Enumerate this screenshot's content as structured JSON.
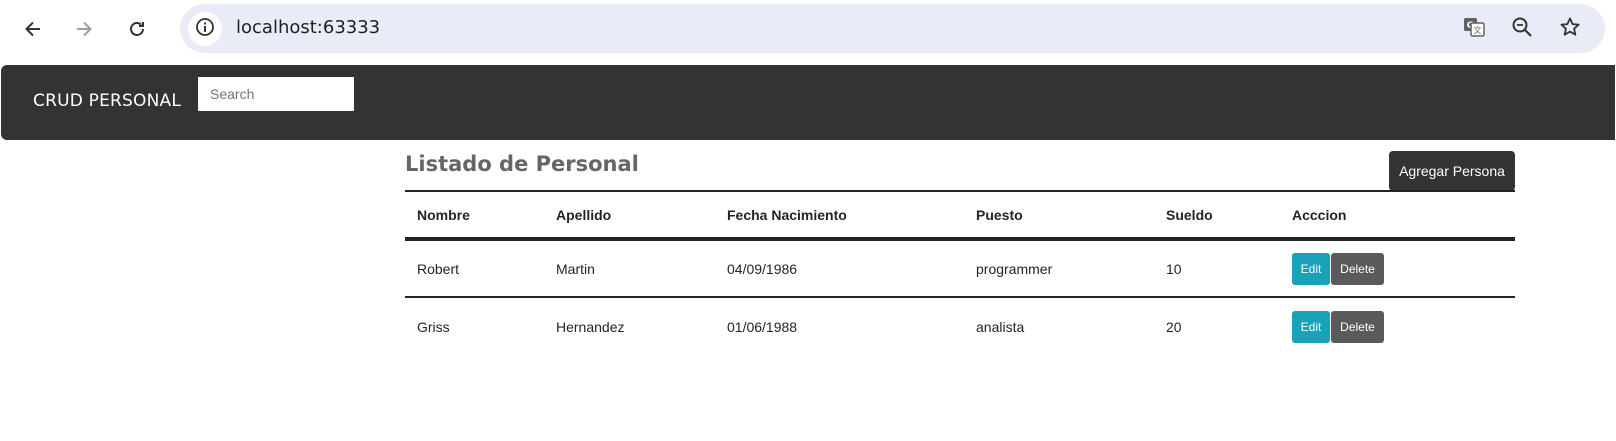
{
  "browser": {
    "url": "localhost:63333"
  },
  "navbar": {
    "brand": "CRUD PERSONAL",
    "search_placeholder": "Search"
  },
  "content": {
    "title": "Listado de Personal",
    "add_button": "Agregar Persona",
    "table": {
      "headers": [
        "Nombre",
        "Apellido",
        "Fecha Nacimiento",
        "Puesto",
        "Sueldo",
        "Acccion"
      ],
      "rows": [
        {
          "nombre": "Robert",
          "apellido": "Martin",
          "fecha": "04/09/1986",
          "puesto": "programmer",
          "sueldo": "10",
          "edit_label": "Edit",
          "delete_label": "Delete"
        },
        {
          "nombre": "Griss",
          "apellido": "Hernandez",
          "fecha": "01/06/1988",
          "puesto": "analista",
          "sueldo": "20",
          "edit_label": "Edit",
          "delete_label": "Delete"
        }
      ]
    }
  },
  "icons": {
    "back": "arrow-left-icon",
    "forward": "arrow-right-icon",
    "reload": "reload-icon",
    "site_info": "info-icon",
    "translate": "translate-icon",
    "zoom": "zoom-out-icon",
    "bookmark": "star-icon"
  },
  "colors": {
    "navbar_bg": "#333333",
    "edit_button": "#17a2b8",
    "delete_button": "#5a5a5a",
    "omnibox_bg": "#e9ecf6"
  }
}
